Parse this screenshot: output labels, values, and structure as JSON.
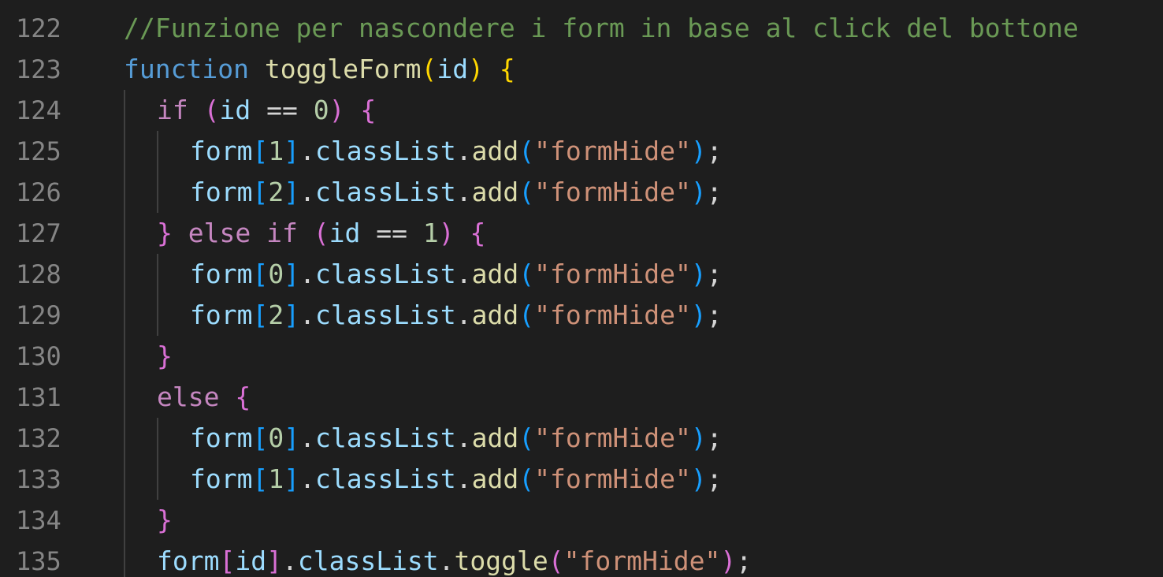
{
  "editor": {
    "colors": {
      "background": "#1e1e1e",
      "line_number": "#858585",
      "comment": "#6a9955",
      "keyword": "#569cd6",
      "control": "#c586c0",
      "function": "#dcdcaa",
      "variable": "#9cdcfe",
      "number": "#b5cea8",
      "string": "#ce9178",
      "bracket_level1": "#ffd700",
      "bracket_level2": "#da70d6",
      "bracket_level3": "#179fff"
    },
    "lines": [
      {
        "number": "122",
        "tokens": [
          {
            "t": "//Funzione per nascondere i form in base al click del bottone",
            "c": "c-comment"
          }
        ]
      },
      {
        "number": "123",
        "tokens": [
          {
            "t": "function",
            "c": "c-kw"
          },
          {
            "t": " ",
            "c": "c-punc"
          },
          {
            "t": "toggleForm",
            "c": "c-fn"
          },
          {
            "t": "(",
            "c": "c-b1"
          },
          {
            "t": "id",
            "c": "c-var"
          },
          {
            "t": ")",
            "c": "c-b1"
          },
          {
            "t": " ",
            "c": "c-punc"
          },
          {
            "t": "{",
            "c": "c-b1"
          }
        ]
      },
      {
        "number": "124",
        "tokens": [
          {
            "t": "if",
            "c": "c-ctrl"
          },
          {
            "t": " ",
            "c": "c-punc"
          },
          {
            "t": "(",
            "c": "c-b2"
          },
          {
            "t": "id",
            "c": "c-var"
          },
          {
            "t": " == ",
            "c": "c-punc"
          },
          {
            "t": "0",
            "c": "c-num"
          },
          {
            "t": ")",
            "c": "c-b2"
          },
          {
            "t": " ",
            "c": "c-punc"
          },
          {
            "t": "{",
            "c": "c-b2"
          }
        ]
      },
      {
        "number": "125",
        "tokens": [
          {
            "t": "form",
            "c": "c-var"
          },
          {
            "t": "[",
            "c": "c-b3"
          },
          {
            "t": "1",
            "c": "c-num"
          },
          {
            "t": "]",
            "c": "c-b3"
          },
          {
            "t": ".",
            "c": "c-punc"
          },
          {
            "t": "classList",
            "c": "c-var"
          },
          {
            "t": ".",
            "c": "c-punc"
          },
          {
            "t": "add",
            "c": "c-fn"
          },
          {
            "t": "(",
            "c": "c-b3"
          },
          {
            "t": "\"formHide\"",
            "c": "c-str"
          },
          {
            "t": ")",
            "c": "c-b3"
          },
          {
            "t": ";",
            "c": "c-punc"
          }
        ]
      },
      {
        "number": "126",
        "tokens": [
          {
            "t": "form",
            "c": "c-var"
          },
          {
            "t": "[",
            "c": "c-b3"
          },
          {
            "t": "2",
            "c": "c-num"
          },
          {
            "t": "]",
            "c": "c-b3"
          },
          {
            "t": ".",
            "c": "c-punc"
          },
          {
            "t": "classList",
            "c": "c-var"
          },
          {
            "t": ".",
            "c": "c-punc"
          },
          {
            "t": "add",
            "c": "c-fn"
          },
          {
            "t": "(",
            "c": "c-b3"
          },
          {
            "t": "\"formHide\"",
            "c": "c-str"
          },
          {
            "t": ")",
            "c": "c-b3"
          },
          {
            "t": ";",
            "c": "c-punc"
          }
        ]
      },
      {
        "number": "127",
        "tokens": [
          {
            "t": "}",
            "c": "c-b2"
          },
          {
            "t": " ",
            "c": "c-punc"
          },
          {
            "t": "else",
            "c": "c-ctrl"
          },
          {
            "t": " ",
            "c": "c-punc"
          },
          {
            "t": "if",
            "c": "c-ctrl"
          },
          {
            "t": " ",
            "c": "c-punc"
          },
          {
            "t": "(",
            "c": "c-b2"
          },
          {
            "t": "id",
            "c": "c-var"
          },
          {
            "t": " == ",
            "c": "c-punc"
          },
          {
            "t": "1",
            "c": "c-num"
          },
          {
            "t": ")",
            "c": "c-b2"
          },
          {
            "t": " ",
            "c": "c-punc"
          },
          {
            "t": "{",
            "c": "c-b2"
          }
        ]
      },
      {
        "number": "128",
        "tokens": [
          {
            "t": "form",
            "c": "c-var"
          },
          {
            "t": "[",
            "c": "c-b3"
          },
          {
            "t": "0",
            "c": "c-num"
          },
          {
            "t": "]",
            "c": "c-b3"
          },
          {
            "t": ".",
            "c": "c-punc"
          },
          {
            "t": "classList",
            "c": "c-var"
          },
          {
            "t": ".",
            "c": "c-punc"
          },
          {
            "t": "add",
            "c": "c-fn"
          },
          {
            "t": "(",
            "c": "c-b3"
          },
          {
            "t": "\"formHide\"",
            "c": "c-str"
          },
          {
            "t": ")",
            "c": "c-b3"
          },
          {
            "t": ";",
            "c": "c-punc"
          }
        ]
      },
      {
        "number": "129",
        "tokens": [
          {
            "t": "form",
            "c": "c-var"
          },
          {
            "t": "[",
            "c": "c-b3"
          },
          {
            "t": "2",
            "c": "c-num"
          },
          {
            "t": "]",
            "c": "c-b3"
          },
          {
            "t": ".",
            "c": "c-punc"
          },
          {
            "t": "classList",
            "c": "c-var"
          },
          {
            "t": ".",
            "c": "c-punc"
          },
          {
            "t": "add",
            "c": "c-fn"
          },
          {
            "t": "(",
            "c": "c-b3"
          },
          {
            "t": "\"formHide\"",
            "c": "c-str"
          },
          {
            "t": ")",
            "c": "c-b3"
          },
          {
            "t": ";",
            "c": "c-punc"
          }
        ]
      },
      {
        "number": "130",
        "tokens": [
          {
            "t": "}",
            "c": "c-b2"
          }
        ]
      },
      {
        "number": "131",
        "tokens": [
          {
            "t": "else",
            "c": "c-ctrl"
          },
          {
            "t": " ",
            "c": "c-punc"
          },
          {
            "t": "{",
            "c": "c-b2"
          }
        ]
      },
      {
        "number": "132",
        "tokens": [
          {
            "t": "form",
            "c": "c-var"
          },
          {
            "t": "[",
            "c": "c-b3"
          },
          {
            "t": "0",
            "c": "c-num"
          },
          {
            "t": "]",
            "c": "c-b3"
          },
          {
            "t": ".",
            "c": "c-punc"
          },
          {
            "t": "classList",
            "c": "c-var"
          },
          {
            "t": ".",
            "c": "c-punc"
          },
          {
            "t": "add",
            "c": "c-fn"
          },
          {
            "t": "(",
            "c": "c-b3"
          },
          {
            "t": "\"formHide\"",
            "c": "c-str"
          },
          {
            "t": ")",
            "c": "c-b3"
          },
          {
            "t": ";",
            "c": "c-punc"
          }
        ]
      },
      {
        "number": "133",
        "tokens": [
          {
            "t": "form",
            "c": "c-var"
          },
          {
            "t": "[",
            "c": "c-b3"
          },
          {
            "t": "1",
            "c": "c-num"
          },
          {
            "t": "]",
            "c": "c-b3"
          },
          {
            "t": ".",
            "c": "c-punc"
          },
          {
            "t": "classList",
            "c": "c-var"
          },
          {
            "t": ".",
            "c": "c-punc"
          },
          {
            "t": "add",
            "c": "c-fn"
          },
          {
            "t": "(",
            "c": "c-b3"
          },
          {
            "t": "\"formHide\"",
            "c": "c-str"
          },
          {
            "t": ")",
            "c": "c-b3"
          },
          {
            "t": ";",
            "c": "c-punc"
          }
        ]
      },
      {
        "number": "134",
        "tokens": [
          {
            "t": "}",
            "c": "c-b2"
          }
        ]
      },
      {
        "number": "135",
        "tokens": [
          {
            "t": "form",
            "c": "c-var"
          },
          {
            "t": "[",
            "c": "c-b2"
          },
          {
            "t": "id",
            "c": "c-var"
          },
          {
            "t": "]",
            "c": "c-b2"
          },
          {
            "t": ".",
            "c": "c-punc"
          },
          {
            "t": "classList",
            "c": "c-var"
          },
          {
            "t": ".",
            "c": "c-punc"
          },
          {
            "t": "toggle",
            "c": "c-fn"
          },
          {
            "t": "(",
            "c": "c-b2"
          },
          {
            "t": "\"formHide\"",
            "c": "c-str"
          },
          {
            "t": ")",
            "c": "c-b2"
          },
          {
            "t": ";",
            "c": "c-punc"
          }
        ]
      }
    ]
  }
}
